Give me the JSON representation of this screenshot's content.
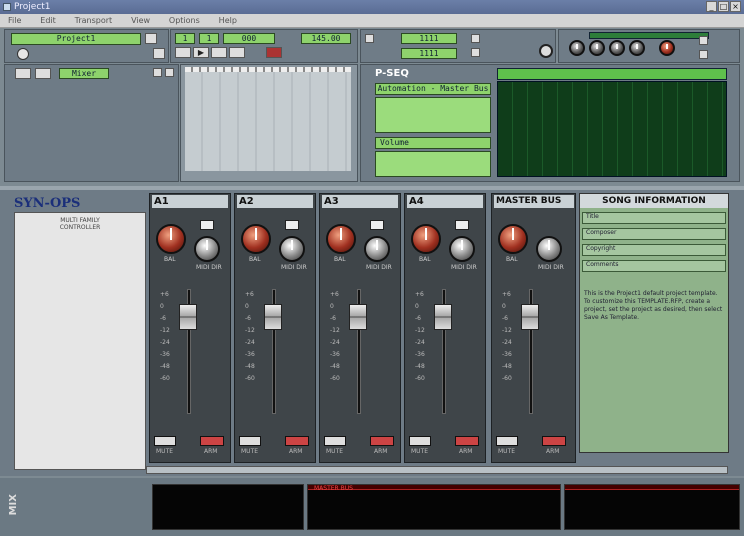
{
  "window": {
    "title": "Project1"
  },
  "menu": [
    "File",
    "Edit",
    "Transport",
    "View",
    "Options",
    "Help"
  ],
  "toolbar": {
    "project_name": "Project1",
    "position_display": [
      "1",
      "1",
      "000"
    ],
    "tempo": "145.00"
  },
  "toolbar_right": {
    "display1": "1111",
    "display2": "1111"
  },
  "views_panel": {
    "label": "Mixer"
  },
  "sequencer": {
    "title": "P-SEQ",
    "automation_label": "Automation - Master Bus",
    "channel_label": "Volume"
  },
  "synops": {
    "title": "SYN-OPS",
    "text": "MULTI FAMILY CONTROLLER"
  },
  "mixer": {
    "strips": [
      {
        "name": "A1",
        "knob_left": "BAL",
        "knob_right": "MIDI DIR",
        "mute": "MUTE",
        "arm": "ARM"
      },
      {
        "name": "A2",
        "knob_left": "BAL",
        "knob_right": "MIDI DIR",
        "mute": "MUTE",
        "arm": "ARM"
      },
      {
        "name": "A3",
        "knob_left": "BAL",
        "knob_right": "MIDI DIR",
        "mute": "MUTE",
        "arm": "ARM"
      },
      {
        "name": "A4",
        "knob_left": "BAL",
        "knob_right": "MIDI DIR",
        "mute": "MUTE",
        "arm": "ARM"
      },
      {
        "name": "MASTER BUS",
        "knob_left": "BAL",
        "knob_right": "MIDI DIR",
        "mute": "MUTE",
        "arm": "ARM"
      }
    ],
    "scale": [
      "+6",
      "0",
      "-6",
      "-12",
      "-24",
      "-36",
      "-48",
      "-60"
    ]
  },
  "song_info": {
    "title": "SONG INFORMATION",
    "fields": [
      "Title",
      "Composer",
      "Copyright",
      "Comments"
    ],
    "body": "This is the Project1 default project template. To customize this TEMPLATE.RFP, create a project, set the project as desired, then select Save As Template."
  },
  "bottom": {
    "mix_label": "MIX",
    "track_label": "MASTER BUS"
  }
}
